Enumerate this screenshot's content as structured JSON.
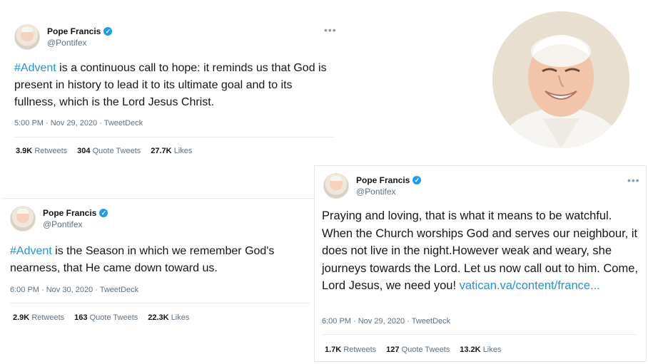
{
  "tweets": [
    {
      "author": "Pope Francis",
      "handle": "@Pontifex",
      "hashtag": "#Advent",
      "text": " is a continuous call to hope: it reminds us that God is present in history to lead it to its ultimate goal and to its fullness, which is the Lord Jesus Christ.",
      "meta": "5:00 PM · Nov 29, 2020 · TweetDeck",
      "retweets": "3.9K",
      "retweets_label": "Retweets",
      "quotes": "304",
      "quotes_label": "Quote Tweets",
      "likes": "27.7K",
      "likes_label": "Likes"
    },
    {
      "author": "Pope Francis",
      "handle": "@Pontifex",
      "hashtag": "#Advent",
      "text": " is the Season in which we remember God's nearness, that He came down toward us.",
      "meta": "6:00 PM · Nov 30, 2020 · TweetDeck",
      "retweets": "2.9K",
      "retweets_label": "Retweets",
      "quotes": "163",
      "quotes_label": "Quote Tweets",
      "likes": "22.3K",
      "likes_label": "Likes"
    },
    {
      "author": "Pope Francis",
      "handle": "@Pontifex",
      "text": "Praying and loving, that is what it means to be watchful. When the Church worships God and serves our neighbour, it does not live in the night.However weak and weary, she journeys towards the Lord. Let us now call out to him. Come, Lord Jesus, we need you! ",
      "link": "vatican.va/content/france...",
      "meta": "6:00 PM · Nov 29, 2020 · TweetDeck",
      "retweets": "1.7K",
      "retweets_label": "Retweets",
      "quotes": "127",
      "quotes_label": "Quote Tweets",
      "likes": "13.2K",
      "likes_label": "Likes"
    }
  ],
  "more_glyph": "•••",
  "verified_glyph": "✓",
  "icons": [
    "verified-badge-icon",
    "more-options-icon"
  ],
  "colors": {
    "link": "#1b95e0",
    "verified": "#1d9bf0",
    "muted": "#5b7083"
  }
}
